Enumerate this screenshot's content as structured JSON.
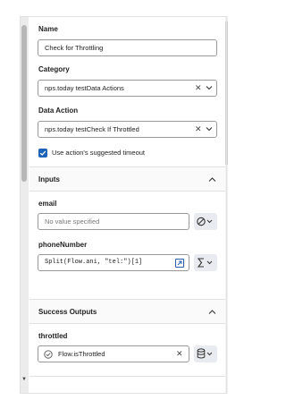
{
  "form": {
    "name_label": "Name",
    "name_value": "Check for Throttling",
    "category_label": "Category",
    "category_value": "nps.today testData Actions",
    "action_label": "Data Action",
    "action_value": "nps.today testCheck If Throttled",
    "timeout_label": "Use action's suggested timeout",
    "timeout_checked": true
  },
  "inputs": {
    "section_title": "Inputs",
    "email_label": "email",
    "email_placeholder": "No value specified",
    "phone_label": "phoneNumber",
    "phone_value": "Split(Flow.ani, \"tel:\")[1]"
  },
  "outputs": {
    "section_title": "Success Outputs",
    "throttled_label": "throttled",
    "throttled_value": "Flow.isThrottled"
  },
  "icons": {
    "clear": "close-icon",
    "dropdown": "chevron-down-icon",
    "collapse": "chevron-up-icon",
    "no_value": "no-value-icon",
    "sigma": "sigma-icon",
    "expand_editor": "expand-editor-icon",
    "variable_ok": "check-circle-icon",
    "database": "database-icon"
  },
  "colors": {
    "accent": "#1b62b8",
    "link": "#1b5fb4",
    "button_bg": "#e8ebef"
  }
}
